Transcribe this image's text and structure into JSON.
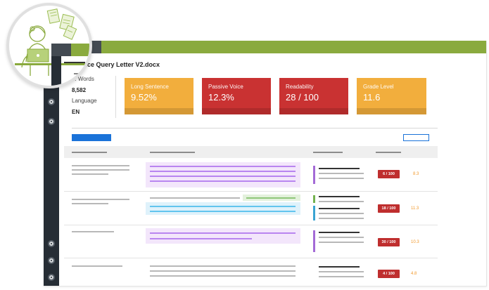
{
  "document": {
    "title": "Insurance Query Letter V2.docx",
    "title_visible": "nsurance Query Letter V2.docx"
  },
  "stats": {
    "words_label": "No. Words",
    "words_label_visible": "o. Words",
    "words_value": "8,582",
    "language_label": "Language",
    "language_value": "EN"
  },
  "cards": [
    {
      "label": "Long Sentence",
      "value": "9.52%",
      "color": "#f2ae3d"
    },
    {
      "label": "Passive Voice",
      "value": "12.3%",
      "color": "#c93232"
    },
    {
      "label": "Readability",
      "value": "28 / 100",
      "color": "#c93232"
    },
    {
      "label": "Grade Level",
      "value": "11.6",
      "color": "#f2ae3d"
    }
  ],
  "rows": [
    {
      "score": "6 / 100",
      "grade": "8.3"
    },
    {
      "score": "18 / 100",
      "grade": "11.3"
    },
    {
      "score": "30 / 100",
      "grade": "10.3"
    },
    {
      "score": "4 / 100",
      "grade": "4.8"
    }
  ],
  "icons": {
    "sidebar": [
      "nav-dot-icon",
      "nav-dot-icon",
      "nav-dot-icon",
      "nav-dot-icon",
      "nav-dot-icon"
    ],
    "illustration": "person-at-laptop-illustration"
  },
  "colors": {
    "accent_green": "#8aaa3e",
    "sidebar_dark": "#262d35",
    "primary_blue": "#1a73d9",
    "alert_red": "#c93232",
    "warning_orange": "#f2ae3d"
  }
}
